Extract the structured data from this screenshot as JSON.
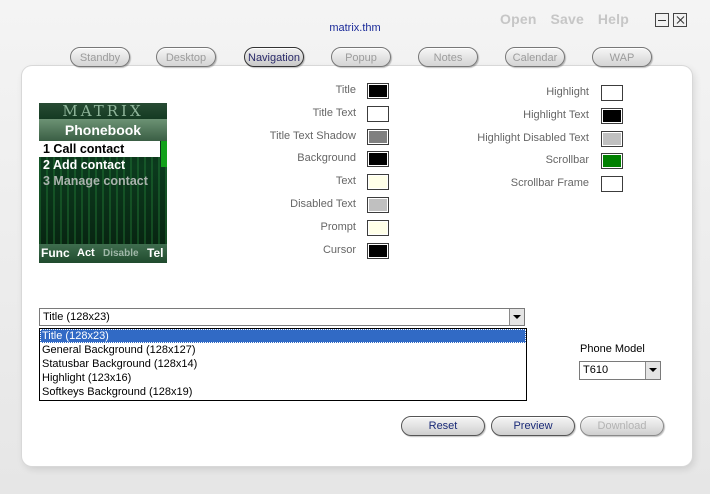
{
  "window": {
    "title": "matrix.thm",
    "menu": [
      "Open",
      "Save",
      "Help"
    ]
  },
  "tabs": [
    {
      "label": "Standby",
      "active": false
    },
    {
      "label": "Desktop",
      "active": false
    },
    {
      "label": "Navigation",
      "active": true
    },
    {
      "label": "Popup",
      "active": false
    },
    {
      "label": "Notes",
      "active": false
    },
    {
      "label": "Calendar",
      "active": false
    },
    {
      "label": "WAP",
      "active": false
    }
  ],
  "preview": {
    "banner": "MATRIX",
    "header": "Phonebook",
    "items": [
      {
        "label": "1 Call contact",
        "state": "selected"
      },
      {
        "label": "2 Add contact",
        "state": "normal"
      },
      {
        "label": "3 Manage contact",
        "state": "disabled"
      }
    ],
    "softkeys": [
      "Func",
      "Act",
      "Disable",
      "Tel"
    ]
  },
  "colors_left": [
    {
      "label": "Title",
      "color": "#000000"
    },
    {
      "label": "Title Text",
      "color": "#ffffff"
    },
    {
      "label": "Title Text Shadow",
      "color": "#808080"
    },
    {
      "label": "Background",
      "color": "#000000"
    },
    {
      "label": "Text",
      "color": "#ffffe8"
    },
    {
      "label": "Disabled Text",
      "color": "#c0c0c0"
    },
    {
      "label": "Prompt",
      "color": "#ffffe8"
    },
    {
      "label": "Cursor",
      "color": "#000000"
    }
  ],
  "colors_right": [
    {
      "label": "Highlight",
      "color": "#ffffff"
    },
    {
      "label": "Highlight Text",
      "color": "#000000"
    },
    {
      "label": "Highlight Disabled Text",
      "color": "#c0c0c0"
    },
    {
      "label": "Scrollbar",
      "color": "#008000"
    },
    {
      "label": "Scrollbar Frame",
      "color": "#ffffff"
    }
  ],
  "element_select": {
    "value": "Title (128x23)",
    "options": [
      "Title (128x23)",
      "General Background (128x127)",
      "Statusbar Background (128x14)",
      "Highlight (123x16)",
      "Softkeys Background (128x19)"
    ]
  },
  "phone_model": {
    "label": "Phone Model",
    "value": "T610"
  },
  "buttons": {
    "reset": "Reset",
    "preview": "Preview",
    "download": "Download"
  }
}
